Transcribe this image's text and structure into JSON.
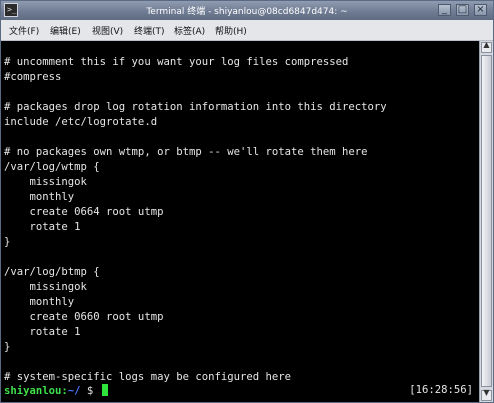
{
  "window": {
    "title": "Terminal 终端 - shiyanlou@08cd6847d474: ~",
    "icon": "terminal-icon",
    "buttons": {
      "minimize": "_",
      "maximize": "□",
      "close": "×"
    }
  },
  "menu": [
    {
      "label": "文件(F)"
    },
    {
      "label": "编辑(E)"
    },
    {
      "label": "视图(V)"
    },
    {
      "label": "终端(T)"
    },
    {
      "label": "标签(A)"
    },
    {
      "label": "帮助(H)"
    }
  ],
  "terminal": {
    "lines": [
      "# uncomment this if you want your log files compressed",
      "#compress",
      "",
      "# packages drop log rotation information into this directory",
      "include /etc/logrotate.d",
      "",
      "# no packages own wtmp, or btmp -- we'll rotate them here",
      "/var/log/wtmp {",
      "    missingok",
      "    monthly",
      "    create 0664 root utmp",
      "    rotate 1",
      "}",
      "",
      "/var/log/btmp {",
      "    missingok",
      "    monthly",
      "    create 0660 root utmp",
      "    rotate 1",
      "}",
      "",
      "# system-specific logs may be configured here"
    ],
    "prompt": {
      "user": "shiyanlou:",
      "path": "~/",
      "symbol": " $ "
    },
    "clock": "[16:28:56]"
  }
}
